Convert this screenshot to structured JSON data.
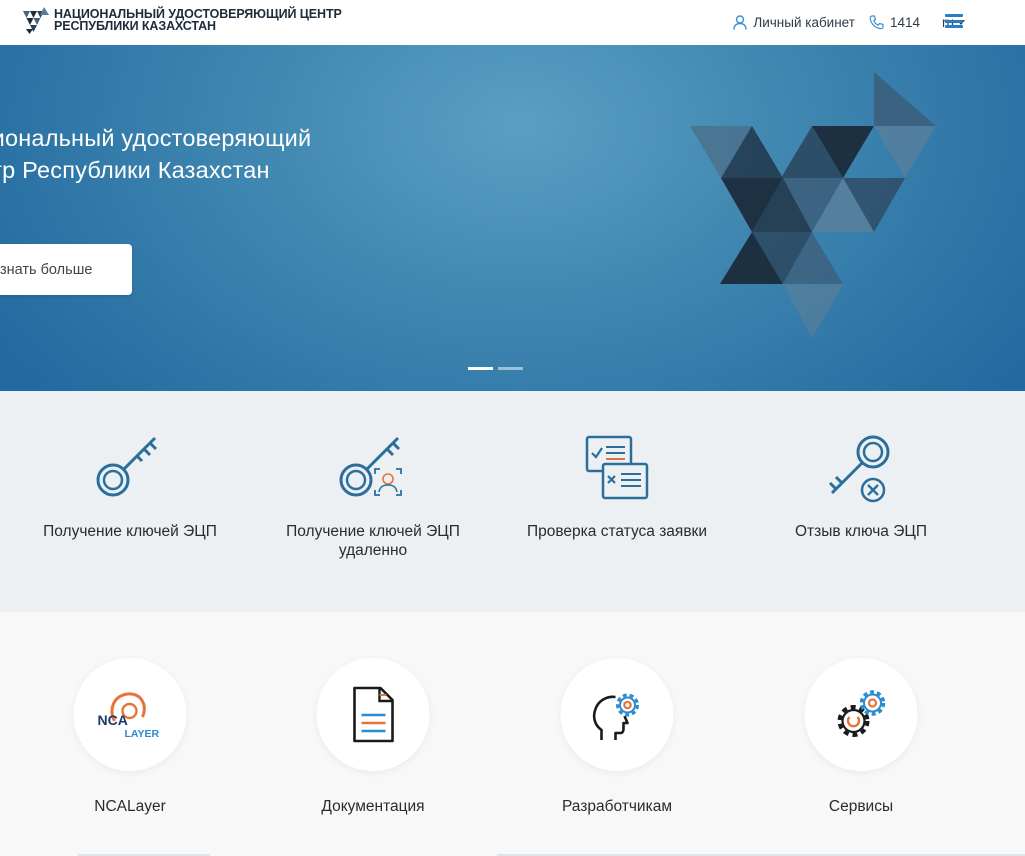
{
  "header": {
    "brand_line1": "НАЦИОНАЛЬНЫЙ УДОСТОВЕРЯЮЩИЙ ЦЕНТР",
    "brand_line2": "РЕСПУБЛИКИ КАЗАХСТАН",
    "cabinet_label": "Личный кабинет",
    "phone": "1414",
    "language": "ru",
    "icons": {
      "logo": "nuc-logo",
      "cabinet": "user-icon",
      "phone": "phone-icon",
      "menu": "hamburger-menu-icon"
    }
  },
  "hero": {
    "title_line1": "циональный удостоверяющий",
    "title_line2": "нтр Республики Казахстан",
    "button_label": "знать больше",
    "slides_count": 2,
    "active_slide": 1
  },
  "services": [
    {
      "label": "Получение ключей ЭЦП",
      "icon": "key-icon"
    },
    {
      "label": "Получение ключей ЭЦП удаленно",
      "icon": "key-face-id-icon"
    },
    {
      "label": "Проверка статуса заявки",
      "icon": "application-status-icon"
    },
    {
      "label": "Отзыв ключа ЭЦП",
      "icon": "key-revoke-icon"
    }
  ],
  "tiles": [
    {
      "label": "NCALayer",
      "icon": "ncalayer-logo-icon",
      "logo_text_top": "NCA",
      "logo_text_bottom": "LAYER"
    },
    {
      "label": "Документация",
      "icon": "document-icon"
    },
    {
      "label": "Разработчикам",
      "icon": "developer-head-gear-icon"
    },
    {
      "label": "Сервисы",
      "icon": "gears-icon"
    }
  ],
  "colors": {
    "accent_blue": "#2a6f9c",
    "brand_dark": "#1d2b3a",
    "accent_orange": "#e8733a",
    "band_bg": "#edf0f3",
    "hero_bg": "#3f86b0"
  }
}
